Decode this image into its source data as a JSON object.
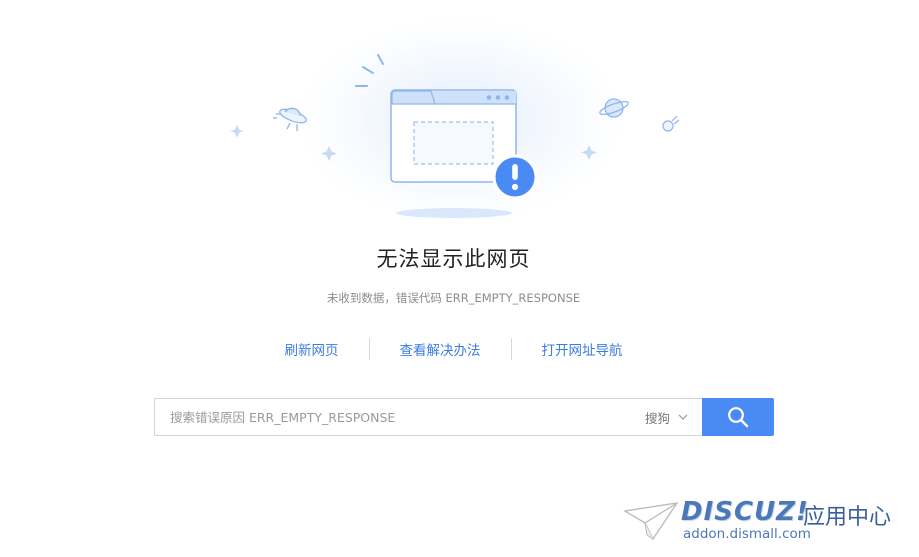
{
  "error": {
    "title": "无法显示此网页",
    "subtitle": "未收到数据，错误代码 ERR_EMPTY_RESPONSE"
  },
  "actions": {
    "refresh": "刷新网页",
    "solutions": "查看解决办法",
    "nav": "打开网址导航"
  },
  "search": {
    "placeholder": "搜索错误原因 ERR_EMPTY_RESPONSE",
    "engine": "搜狗"
  },
  "watermark": {
    "brand": "DISCUZ!",
    "brand_cn": "应用中心",
    "url": "addon.dismall.com"
  },
  "colors": {
    "accent": "#4a8af4",
    "link": "#3b7ddd",
    "alert": "#4a8af4"
  }
}
